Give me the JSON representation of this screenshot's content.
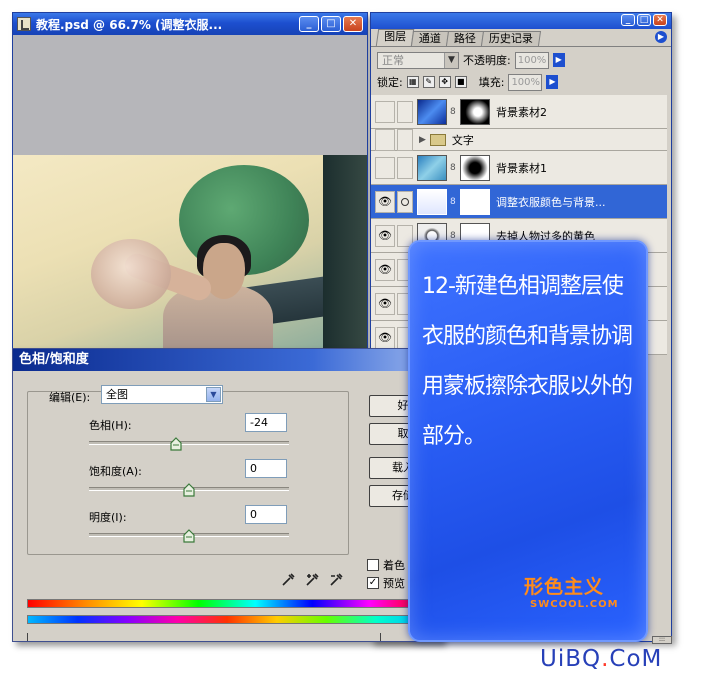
{
  "document_window": {
    "title": "教程.psd @ 66.7% (调整衣服...",
    "controls": {
      "minimize": "_",
      "maximize": "□",
      "close": "✕"
    }
  },
  "layers_panel": {
    "controls": {
      "minimize": "_",
      "maximize": "□",
      "close": "✕"
    },
    "tabs": [
      {
        "label": "图层",
        "active": true
      },
      {
        "label": "通道",
        "active": false
      },
      {
        "label": "路径",
        "active": false
      },
      {
        "label": "历史记录",
        "active": false
      }
    ],
    "blend_mode": "正常",
    "opacity_label": "不透明度:",
    "opacity_value": "100%",
    "lock_label": "锁定:",
    "fill_label": "填充:",
    "fill_value": "100%",
    "layers": [
      {
        "name": "背景素材2",
        "visible": false,
        "type": "image-mask"
      },
      {
        "name": "文字",
        "visible": false,
        "type": "folder"
      },
      {
        "name": "背景素材1",
        "visible": false,
        "type": "image-mask"
      },
      {
        "name": "调整衣服颜色与背景...",
        "visible": true,
        "selected": true,
        "type": "adjustment"
      },
      {
        "name": "去掉人物过多的黄色",
        "visible": true,
        "type": "adjustment"
      },
      {
        "name": "",
        "visible": true,
        "type": "hidden"
      },
      {
        "name": "",
        "visible": true,
        "type": "hidden"
      },
      {
        "name": "",
        "visible": true,
        "type": "hidden"
      }
    ]
  },
  "dialog": {
    "title": "色相/饱和度",
    "edit_label": "编辑(E):",
    "edit_value": "全图",
    "hue_label": "色相(H):",
    "hue_value": "-24",
    "hue_position": 0.433,
    "saturation_label": "饱和度(A):",
    "saturation_value": "0",
    "saturation_position": 0.5,
    "lightness_label": "明度(I):",
    "lightness_value": "0",
    "lightness_position": 0.5,
    "buttons": {
      "ok": "好",
      "cancel": "取",
      "load": "载入",
      "save": "存储"
    },
    "colorize_label": "着色",
    "colorize_checked": false,
    "preview_label": "预览",
    "preview_checked": true
  },
  "overlay": {
    "caption": "12-新建色相调整层使衣服的颜色和背景协调用蒙板擦除衣服以外的部分。",
    "logo_cn": "形色主义",
    "logo_en": "SWCOOL.COM"
  },
  "watermark": {
    "part1": "UiBQ",
    "dot": ".",
    "part2": "CoM"
  }
}
